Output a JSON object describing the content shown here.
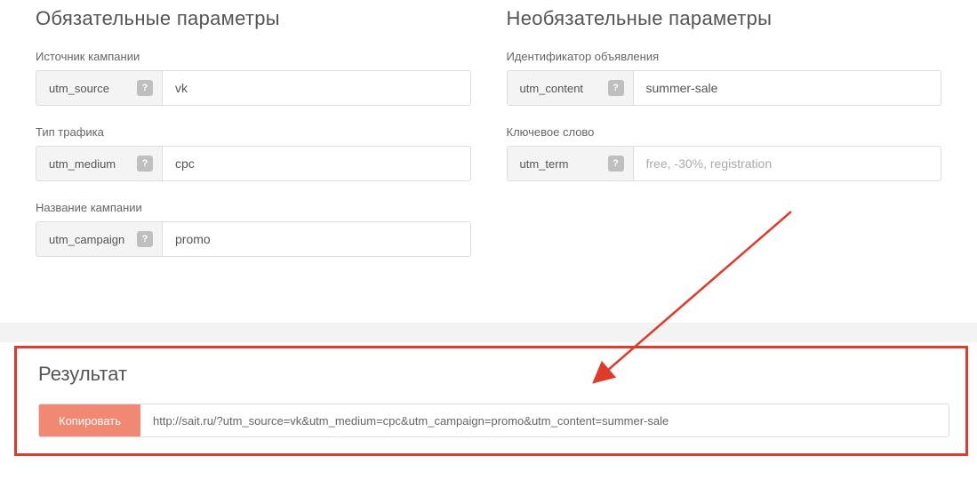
{
  "required": {
    "title": "Обязательные параметры",
    "fields": [
      {
        "label": "Источник кампании",
        "param": "utm_source",
        "value": "vk",
        "placeholder": ""
      },
      {
        "label": "Тип трафика",
        "param": "utm_medium",
        "value": "cpc",
        "placeholder": ""
      },
      {
        "label": "Название кампании",
        "param": "utm_campaign",
        "value": "promo",
        "placeholder": ""
      }
    ]
  },
  "optional": {
    "title": "Необязательные параметры",
    "fields": [
      {
        "label": "Идентификатор объявления",
        "param": "utm_content",
        "value": "summer-sale",
        "placeholder": ""
      },
      {
        "label": "Ключевое слово",
        "param": "utm_term",
        "value": "",
        "placeholder": "free, -30%, registration"
      }
    ]
  },
  "help_glyph": "?",
  "result": {
    "title": "Результат",
    "copy_label": "Копировать",
    "url": "http://sait.ru/?utm_source=vk&utm_medium=cpc&utm_campaign=promo&utm_content=summer-sale"
  }
}
